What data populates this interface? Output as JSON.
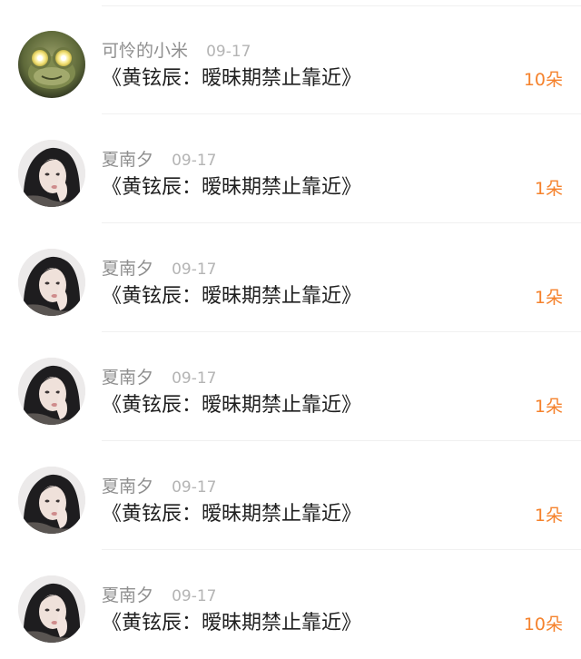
{
  "colors": {
    "name": "#8f8f8f",
    "date": "#b4b4b4",
    "title": "#1f1f1f",
    "count": "#f5822c",
    "divider": "#f0f0f0"
  },
  "items": [
    {
      "user": "可怜的小米",
      "date": "09-17",
      "title": "《黄铉辰：暧昧期禁止靠近》",
      "count": "10朵",
      "avatar_icon": "frog-avatar"
    },
    {
      "user": "夏南夕",
      "date": "09-17",
      "title": "《黄铉辰：暧昧期禁止靠近》",
      "count": "1朵",
      "avatar_icon": "girl-avatar"
    },
    {
      "user": "夏南夕",
      "date": "09-17",
      "title": "《黄铉辰：暧昧期禁止靠近》",
      "count": "1朵",
      "avatar_icon": "girl-avatar"
    },
    {
      "user": "夏南夕",
      "date": "09-17",
      "title": "《黄铉辰：暧昧期禁止靠近》",
      "count": "1朵",
      "avatar_icon": "girl-avatar"
    },
    {
      "user": "夏南夕",
      "date": "09-17",
      "title": "《黄铉辰：暧昧期禁止靠近》",
      "count": "1朵",
      "avatar_icon": "girl-avatar"
    },
    {
      "user": "夏南夕",
      "date": "09-17",
      "title": "《黄铉辰：暧昧期禁止靠近》",
      "count": "10朵",
      "avatar_icon": "girl-avatar"
    }
  ]
}
